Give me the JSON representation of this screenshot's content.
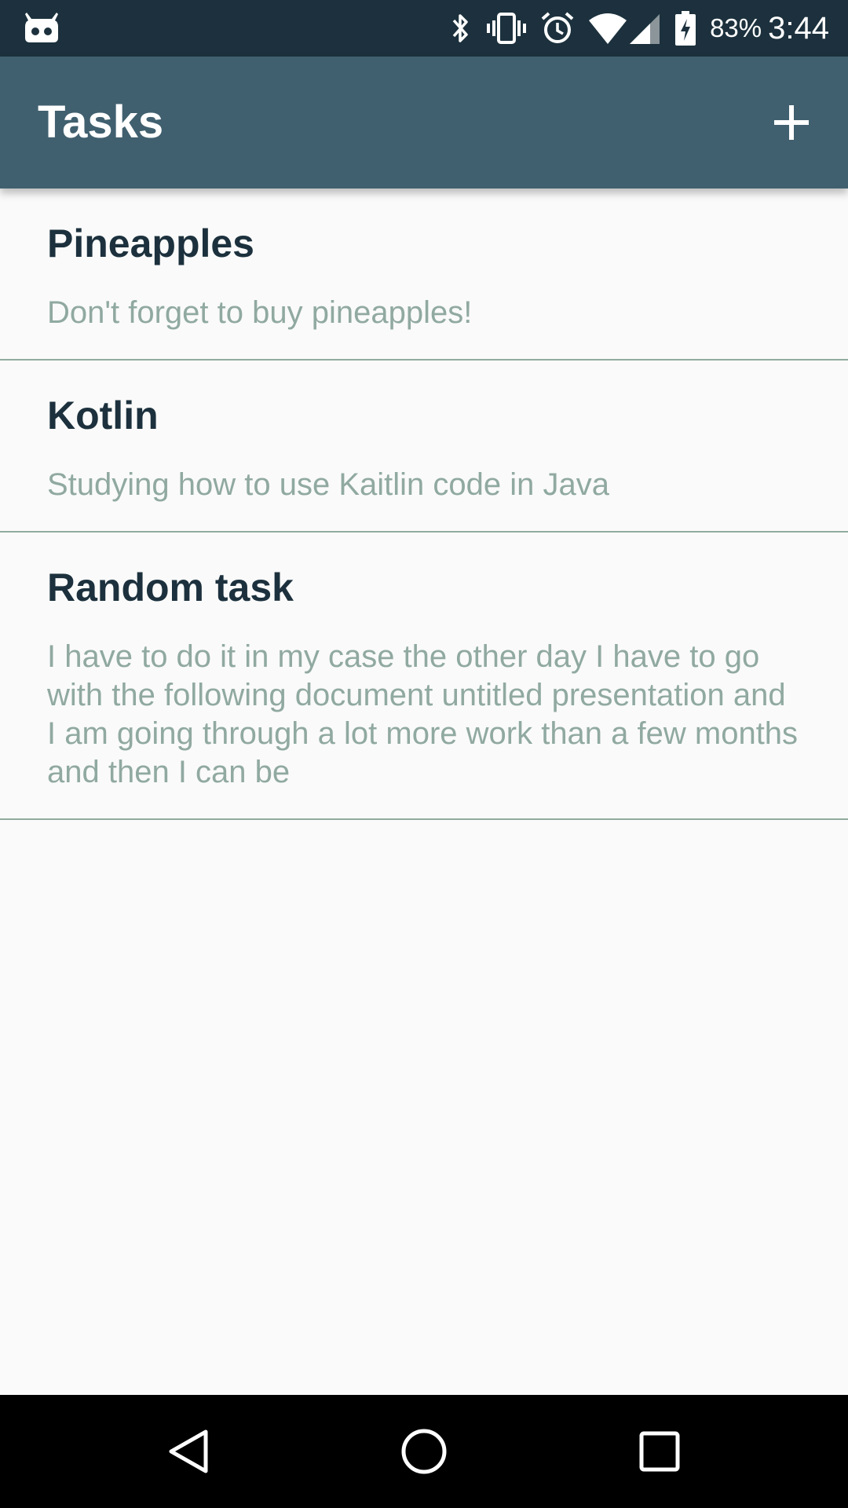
{
  "status_bar": {
    "left_icon": "cyanogen-mascot-icon",
    "icons": [
      "bluetooth-icon",
      "vibrate-icon",
      "alarm-icon",
      "wifi-icon",
      "cell-signal-icon",
      "battery-charging-icon"
    ],
    "battery_percent": "83%",
    "time": "3:44"
  },
  "toolbar": {
    "title": "Tasks",
    "add_icon": "plus-icon"
  },
  "tasks": [
    {
      "title": "Pineapples",
      "description": "Don't forget to buy pineapples!"
    },
    {
      "title": "Kotlin",
      "description": "Studying how to use Kaitlin code in Java"
    },
    {
      "title": "Random task",
      "description": "I have to do it in my case the other day I have to go with the following document untitled presentation and I am going through a lot more work than a few months and then I can be"
    }
  ],
  "nav_bar": {
    "back_icon": "back-triangle-icon",
    "home_icon": "home-circle-icon",
    "recents_icon": "recents-square-icon"
  },
  "colors": {
    "status_bar": "#1c313d",
    "toolbar": "#41606f",
    "title_text": "#1c313d",
    "desc_text": "#90a9a1",
    "divider": "#90ab9e",
    "background": "#fafafa"
  }
}
